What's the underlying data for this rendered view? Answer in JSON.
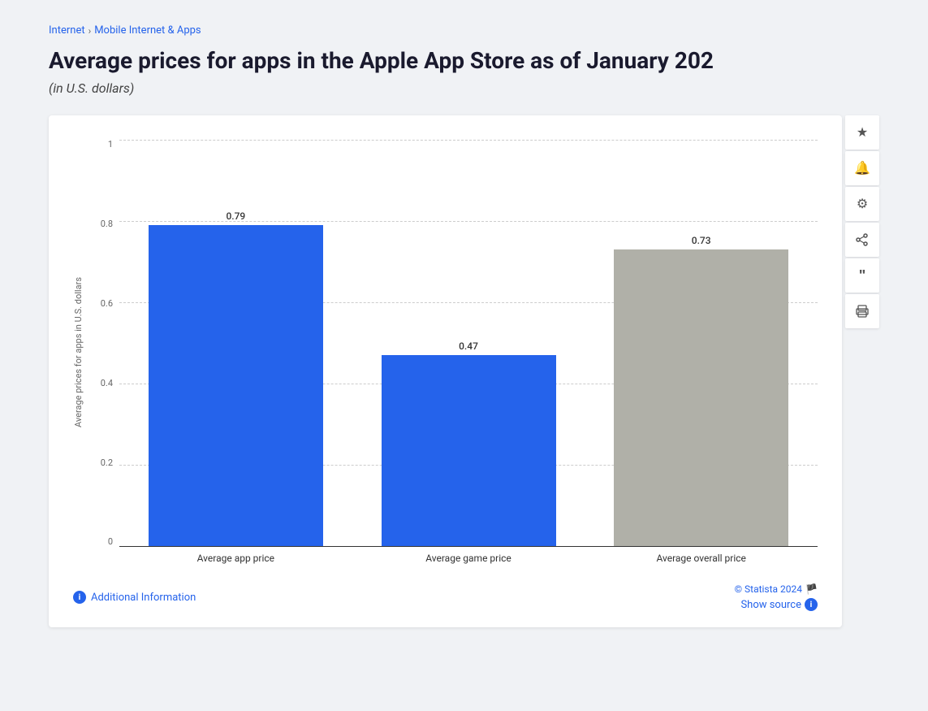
{
  "breadcrumb": {
    "items": [
      "Internet",
      "Mobile Internet & Apps"
    ],
    "separator": "›"
  },
  "title": "Average prices for apps in the Apple App Store as of January 202",
  "subtitle": "(in U.S. dollars)",
  "chart": {
    "y_axis_label": "Average prices for apps in U.S. dollars",
    "y_ticks": [
      "0",
      "0.2",
      "0.4",
      "0.6",
      "0.8",
      "1"
    ],
    "bars": [
      {
        "id": "avg-app-price",
        "label": "Average app price",
        "value": 0.79,
        "color": "blue"
      },
      {
        "id": "avg-game-price",
        "label": "Average game price",
        "value": 0.47,
        "color": "blue"
      },
      {
        "id": "avg-overall-price",
        "label": "Average overall price",
        "value": 0.73,
        "color": "gray"
      }
    ],
    "max_value": 1.0
  },
  "footer": {
    "additional_info_label": "Additional Information",
    "statista_credit": "© Statista 2024",
    "show_source_label": "Show source"
  },
  "sidebar_actions": [
    {
      "id": "star",
      "icon": "★",
      "label": "Bookmark"
    },
    {
      "id": "bell",
      "icon": "🔔",
      "label": "Alert"
    },
    {
      "id": "gear",
      "icon": "⚙",
      "label": "Settings"
    },
    {
      "id": "share",
      "icon": "⋮",
      "label": "Share"
    },
    {
      "id": "quote",
      "icon": "❝",
      "label": "Cite"
    },
    {
      "id": "print",
      "icon": "🖨",
      "label": "Print"
    }
  ]
}
